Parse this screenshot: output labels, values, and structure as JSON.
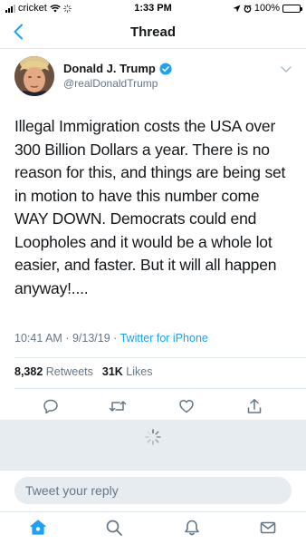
{
  "status_bar": {
    "carrier": "cricket",
    "time": "1:33 PM",
    "battery": "100%",
    "icons": [
      "signal-icon",
      "wifi-icon",
      "activity-icon",
      "location-icon",
      "alarm-icon",
      "battery-icon"
    ]
  },
  "header": {
    "title": "Thread",
    "back_icon": "chevron-left-icon"
  },
  "tweet": {
    "author_name": "Donald J. Trump",
    "author_handle": "@realDonaldTrump",
    "verified": true,
    "text": "Illegal Immigration costs the USA over 300 Billion Dollars a year. There is no reason for this, and things are being set in motion to have this number come WAY DOWN. Democrats could end Loopholes and it would be a whole lot easier, and faster. But it will all happen anyway!....",
    "time": "10:41 AM",
    "date": "9/13/19",
    "separator": "·",
    "source": "Twitter for iPhone",
    "retweets_count": "8,382",
    "retweets_label": "Retweets",
    "likes_count": "31K",
    "likes_label": "Likes"
  },
  "actions": [
    "reply-icon",
    "retweet-icon",
    "like-icon",
    "share-icon"
  ],
  "reply": {
    "placeholder": "Tweet your reply"
  },
  "tab_bar": {
    "items": [
      "home-icon",
      "search-icon",
      "notifications-icon",
      "messages-icon"
    ]
  },
  "colors": {
    "accent": "#1da1f2",
    "text": "#14171a",
    "secondary": "#657786",
    "border": "#e1e8ed",
    "background_gray": "#e6ecf0"
  }
}
